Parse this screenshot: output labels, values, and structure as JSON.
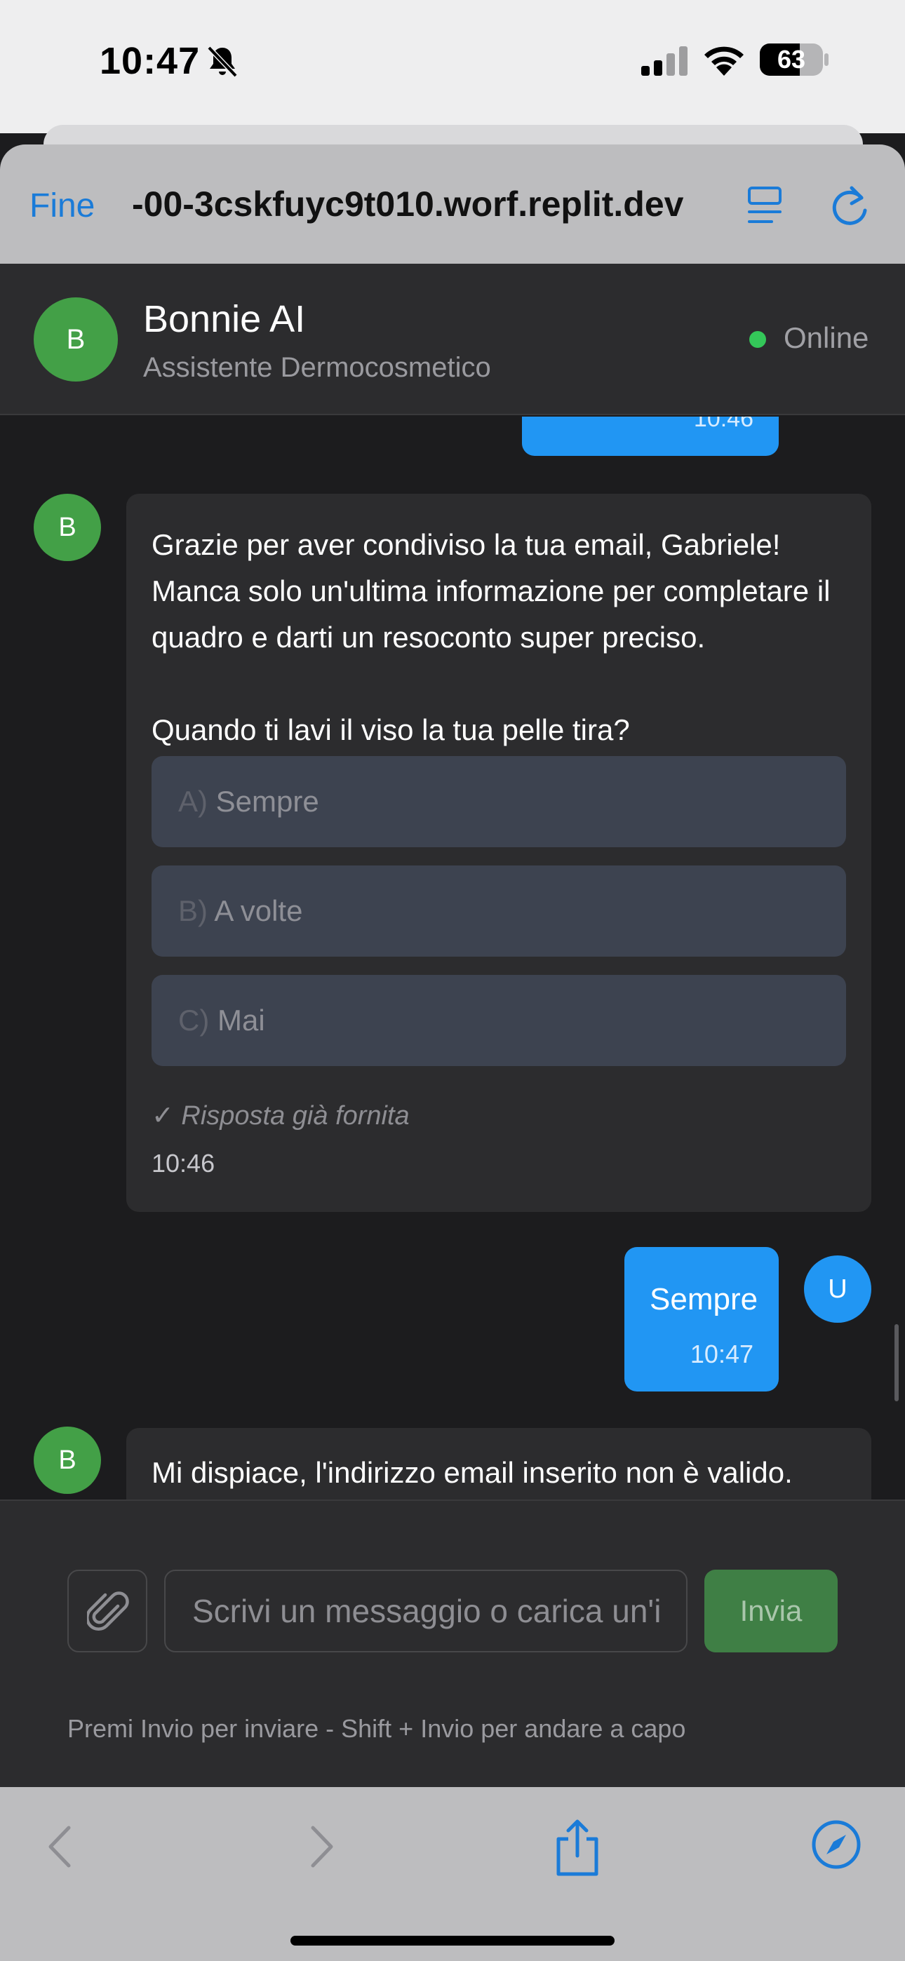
{
  "status_bar": {
    "time": "10:47",
    "battery": "63",
    "battery_level": 0.63
  },
  "browser": {
    "done_label": "Fine",
    "url": "-00-3cskfuyc9t010.worf.replit.dev",
    "icons": [
      "reader-icon",
      "reload-icon"
    ]
  },
  "chat_header": {
    "avatar_initial": "B",
    "name": "Bonnie AI",
    "subtitle": "Assistente Dermocosmetico",
    "status": "Online",
    "status_color": "#34c759"
  },
  "messages": {
    "previous_user_time": "10:46",
    "bot_message": {
      "avatar_initial": "B",
      "paragraph1": "Grazie per aver condiviso la tua email, Gabriele! Manca solo un'ultima informazione per completare il quadro e darti un resoconto super preciso.",
      "paragraph2": "Quando ti lavi il viso la tua pelle tira?",
      "options": [
        {
          "key": "A)",
          "label": "Sempre"
        },
        {
          "key": "B)",
          "label": "A volte"
        },
        {
          "key": "C)",
          "label": "Mai"
        }
      ],
      "answered_note": "✓ Risposta già fornita",
      "time": "10:46"
    },
    "user_reply": {
      "avatar_initial": "U",
      "text": "Sempre",
      "time": "10:47"
    },
    "bot_message_2": {
      "avatar_initial": "B",
      "text": "Mi dispiace, l'indirizzo email inserito non è valido."
    }
  },
  "composer": {
    "placeholder": "Scrivi un messaggio o carica un'immagine",
    "send_label": "Invia",
    "hint": "Premi Invio per inviare - Shift + Invio per andare a capo"
  },
  "colors": {
    "user_bubble": "#2196f3",
    "bot_avatar": "#43a047",
    "send_button": "#3f7f45",
    "link_blue": "#1a7bd8"
  }
}
